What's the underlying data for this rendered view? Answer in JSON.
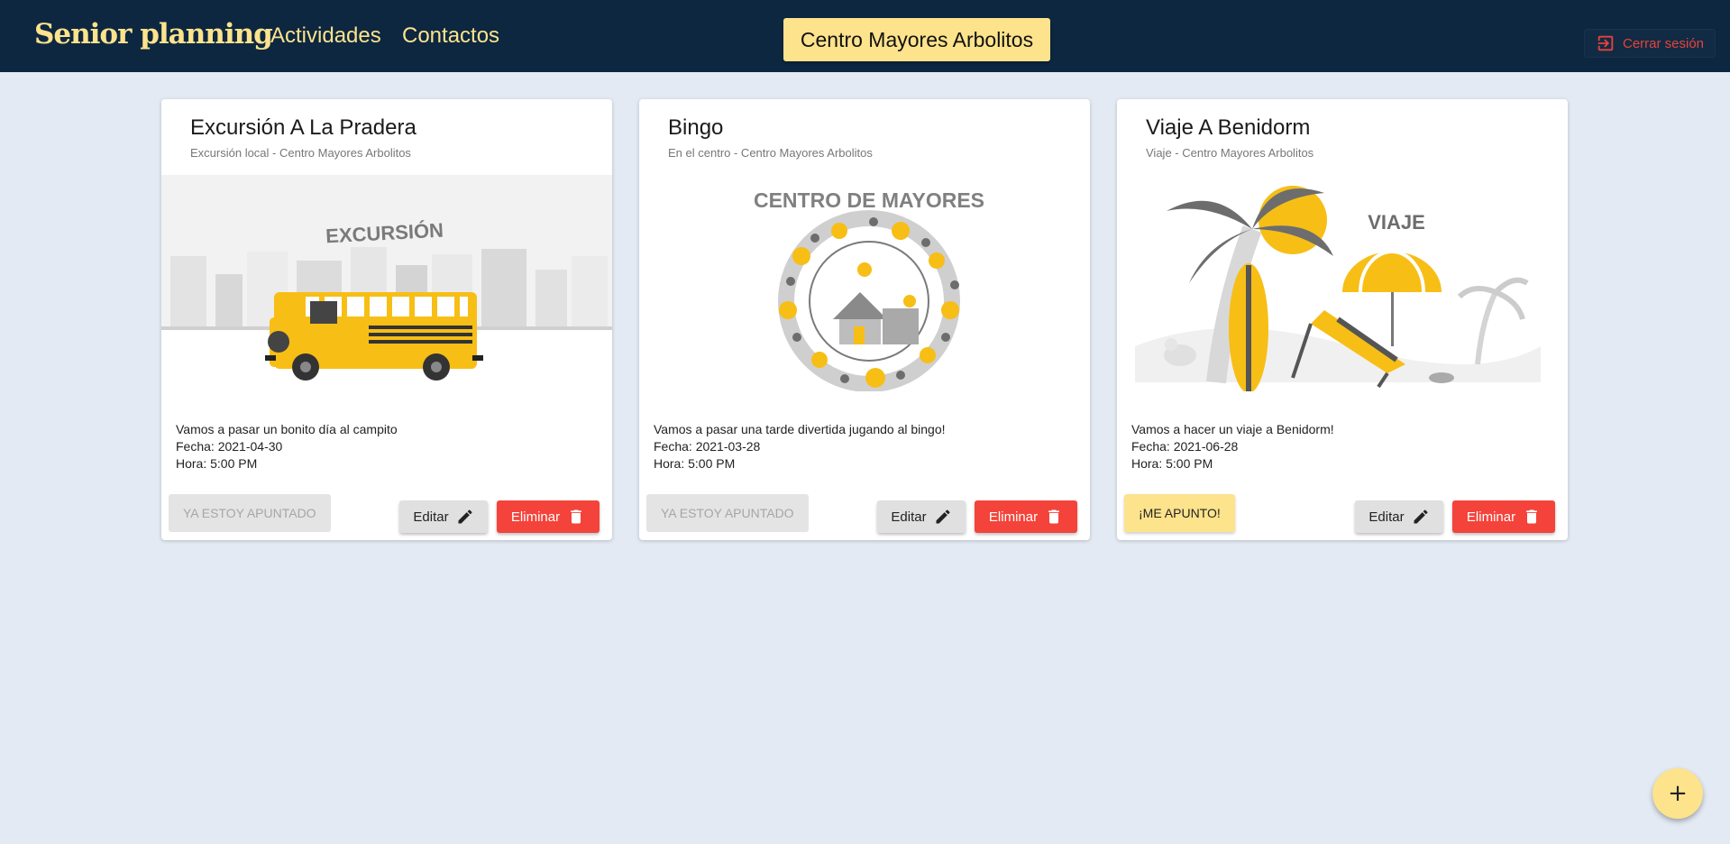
{
  "app": {
    "brand": "Senior planning",
    "nav": {
      "activities": "Actividades",
      "contacts": "Contactos"
    },
    "center_name": "Centro Mayores Arbolitos",
    "logout_label": "Cerrar sesión"
  },
  "colors": {
    "topbar": "#0d2741",
    "accent_yellow": "#fde38c",
    "danger_red": "#f4433a",
    "background": "#e3eaf3"
  },
  "cards": [
    {
      "title": "Excursión A La Pradera",
      "subtitle": "Excursión local - Centro Mayores Arbolitos",
      "image_text": "EXCURSIÓN",
      "description": "Vamos a pasar un bonito día al campito",
      "date": "Fecha: 2021-04-30",
      "time": "Hora: 5:00 PM",
      "join_label": "YA ESTOY APUNTADO",
      "edit_label": "Editar",
      "delete_label": "Eliminar"
    },
    {
      "title": "Bingo",
      "subtitle": "En el centro - Centro Mayores Arbolitos",
      "image_text": "CENTRO DE MAYORES",
      "description": "Vamos a pasar una tarde divertida jugando al bingo!",
      "date": "Fecha: 2021-03-28",
      "time": "Hora: 5:00 PM",
      "join_label": "YA ESTOY APUNTADO",
      "edit_label": "Editar",
      "delete_label": "Eliminar"
    },
    {
      "title": "Viaje A Benidorm",
      "subtitle": "Viaje - Centro Mayores Arbolitos",
      "image_text": "VIAJE",
      "description": "Vamos a hacer un viaje a Benidorm!",
      "date": "Fecha: 2021-06-28",
      "time": "Hora: 5:00 PM",
      "join_label": "¡ME APUNTO!",
      "edit_label": "Editar",
      "delete_label": "Eliminar"
    }
  ],
  "fab_label": "+"
}
